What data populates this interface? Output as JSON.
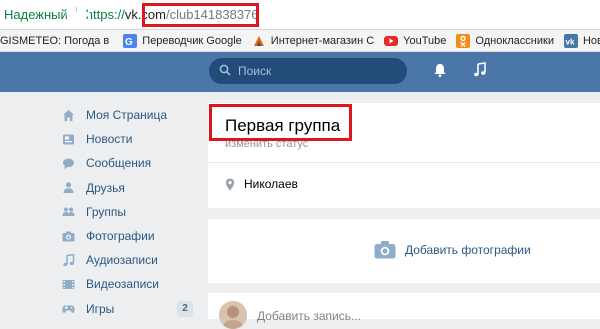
{
  "browser": {
    "secure_label": "Надежный",
    "url_scheme": "https://",
    "url_host": "vk.com",
    "url_path": "/club141838376"
  },
  "bookmarks": [
    {
      "label": "GISMETEO: Погода в",
      "icon": "gismeteo-icon"
    },
    {
      "label": "Переводчик Google",
      "icon": "google-translate-icon"
    },
    {
      "label": "Интернет-магазин С",
      "icon": "shop-icon"
    },
    {
      "label": "YouTube",
      "icon": "youtube-icon"
    },
    {
      "label": "Одноклассники",
      "icon": "odnoklassniki-icon"
    },
    {
      "label": "Новости",
      "icon": "vk-icon"
    }
  ],
  "header": {
    "search_placeholder": "Поиск"
  },
  "sidebar": {
    "items": [
      {
        "label": "Моя Страница",
        "icon": "home-icon"
      },
      {
        "label": "Новости",
        "icon": "news-icon"
      },
      {
        "label": "Сообщения",
        "icon": "messages-icon"
      },
      {
        "label": "Друзья",
        "icon": "friends-icon"
      },
      {
        "label": "Группы",
        "icon": "groups-icon"
      },
      {
        "label": "Фотографии",
        "icon": "camera-icon"
      },
      {
        "label": "Аудиозаписи",
        "icon": "music-icon"
      },
      {
        "label": "Видеозаписи",
        "icon": "video-icon"
      },
      {
        "label": "Игры",
        "icon": "games-icon",
        "badge": "2"
      }
    ]
  },
  "group": {
    "name": "Первая группа",
    "status_link": "изменить статус",
    "city": "Николаев",
    "add_photos": "Добавить фотографии",
    "post_placeholder": "Добавить запись..."
  },
  "colors": {
    "vk_blue": "#4a76a8",
    "link": "#2a5885",
    "highlight": "#e0141e",
    "secure_green": "#0b8043"
  }
}
